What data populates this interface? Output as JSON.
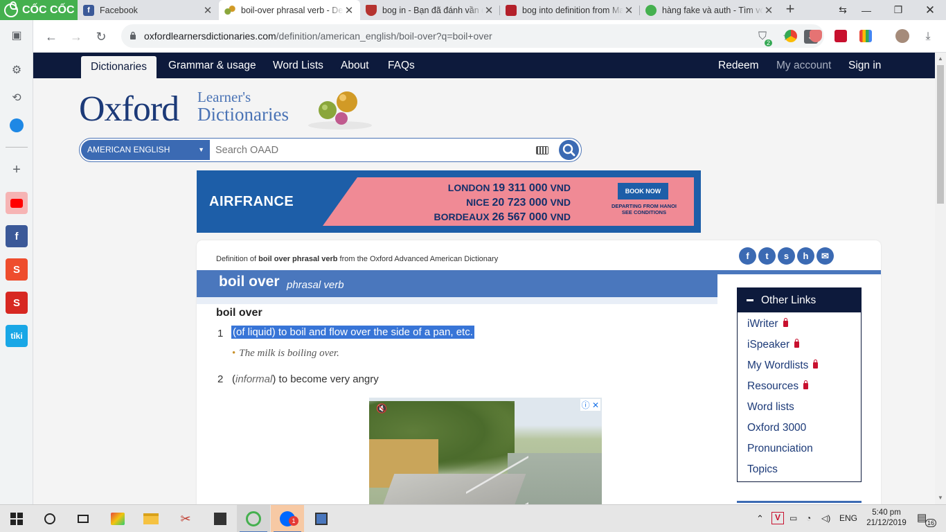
{
  "browser": {
    "brand": "CỐC CỐC",
    "tabs": [
      {
        "title": "Facebook",
        "icon": "facebook-icon"
      },
      {
        "title": "boil-over phrasal verb - Def",
        "icon": "oxford-balls-icon"
      },
      {
        "title": "bog in - Bạn đã đánh vần đ",
        "icon": "cambridge-shield-icon"
      },
      {
        "title": "bog into definition from Ma",
        "icon": "macmillan-book-icon"
      },
      {
        "title": "hàng fake và auth - Tìm với",
        "icon": "coccoc-search-icon"
      }
    ],
    "url_host": "oxfordlearnersdictionaries.com",
    "url_path": "/definition/american_english/boil-over?q=boil+over",
    "extension_badge": "2"
  },
  "site": {
    "nav": {
      "dictionaries": "Dictionaries",
      "grammar": "Grammar & usage",
      "wordlists": "Word Lists",
      "about": "About",
      "faqs": "FAQs",
      "redeem": "Redeem",
      "my_account": "My account",
      "sign_in": "Sign in"
    },
    "logo": {
      "main": "Oxford",
      "line1": "Learner's",
      "line2": "Dictionaries"
    },
    "search": {
      "dictionary": "AMERICAN ENGLISH",
      "placeholder": "Search OAAD"
    }
  },
  "ad": {
    "brand": "AIRFRANCE",
    "offers": [
      {
        "city": "LONDON",
        "price": "19 311 000",
        "currency": "VND"
      },
      {
        "city": "NICE",
        "price": "20 723 000",
        "currency": "VND"
      },
      {
        "city": "BORDEAUX",
        "price": "26 567 000",
        "currency": "VND"
      }
    ],
    "cta": "BOOK NOW",
    "conditions": "DEPARTING FROM HANOI SEE CONDITIONS"
  },
  "entry": {
    "def_of_prefix": "Definition of ",
    "def_of_word": "boil over phrasal verb",
    "def_of_suffix": " from the Oxford Advanced American Dictionary",
    "headword": "boil over",
    "pos": "phrasal verb",
    "subheadword": "boil over",
    "senses": [
      {
        "num": "1",
        "definition": "(of liquid) to boil and flow over the side of a pan, etc.",
        "example": "The milk is boiling over."
      },
      {
        "num": "2",
        "label": "informal",
        "definition": "to become very angry"
      }
    ]
  },
  "other_links": {
    "heading": "Other Links",
    "items": [
      "iWriter",
      "iSpeaker",
      "My Wordlists",
      "Resources",
      "Word lists",
      "Oxford 3000",
      "Pronunciation",
      "Topics"
    ],
    "locked": [
      true,
      true,
      true,
      true,
      false,
      false,
      false,
      false
    ]
  },
  "taskbar": {
    "time": "5:40 pm",
    "date": "21/12/2019",
    "lang": "ENG",
    "notif_count": "16",
    "zalo_badge": "1"
  }
}
